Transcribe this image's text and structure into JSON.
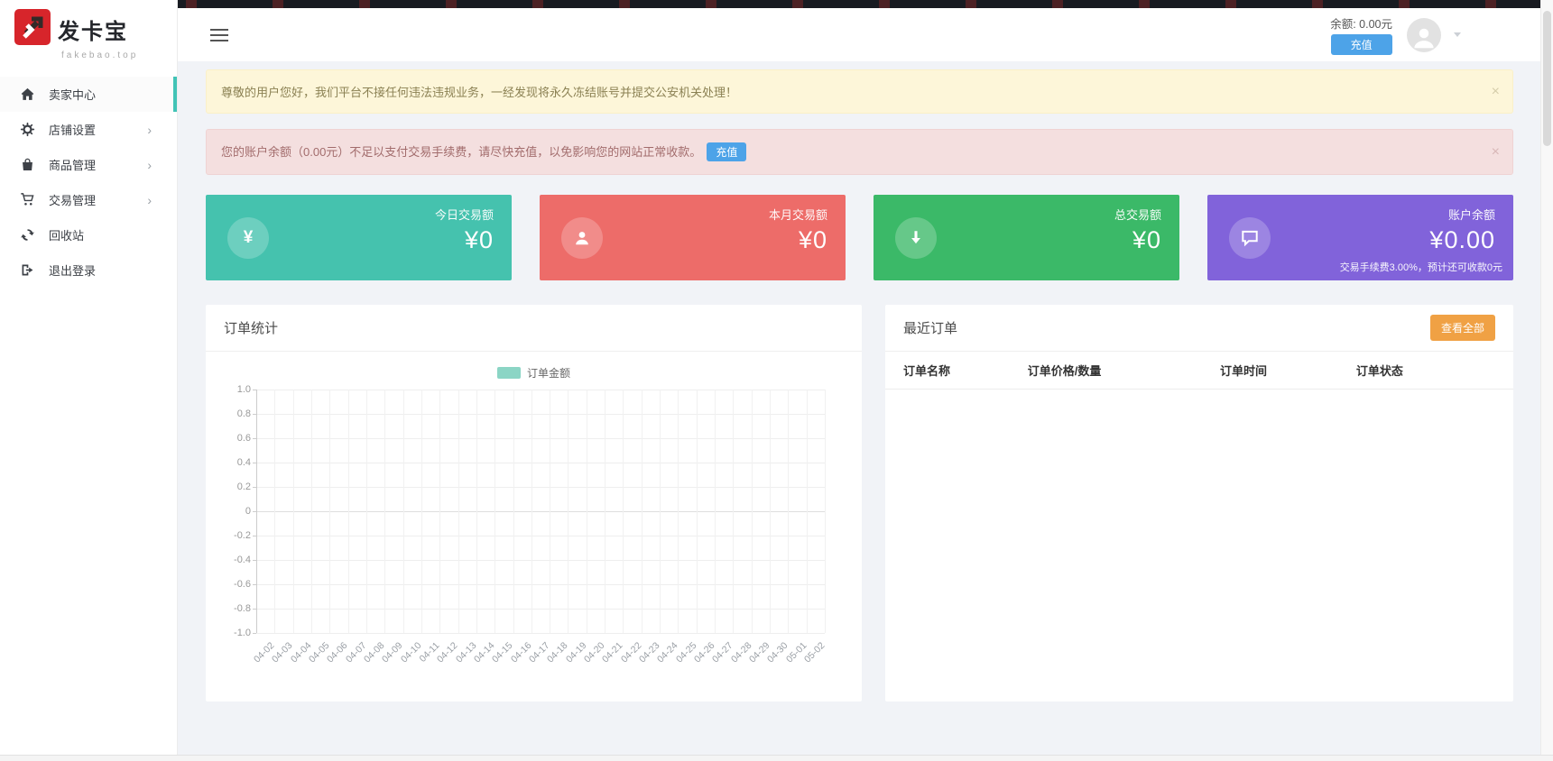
{
  "brand": {
    "name": "发卡宝",
    "domain": "fakebao.top"
  },
  "topbar": {
    "balance_label": "余额: 0.00元",
    "recharge_button": "充值"
  },
  "sidebar": {
    "items": [
      {
        "key": "seller-center",
        "label": "卖家中心",
        "icon": "home-icon",
        "active": true,
        "has_children": false
      },
      {
        "key": "shop-settings",
        "label": "店铺设置",
        "icon": "gear-icon",
        "active": false,
        "has_children": true
      },
      {
        "key": "product-management",
        "label": "商品管理",
        "icon": "bag-icon",
        "active": false,
        "has_children": true
      },
      {
        "key": "trade-management",
        "label": "交易管理",
        "icon": "cart-icon",
        "active": false,
        "has_children": true
      },
      {
        "key": "recycle-bin",
        "label": "回收站",
        "icon": "recycle-icon",
        "active": false,
        "has_children": false
      },
      {
        "key": "logout",
        "label": "退出登录",
        "icon": "logout-icon",
        "active": false,
        "has_children": false
      }
    ],
    "chevron": "›"
  },
  "alerts": [
    {
      "type": "warning",
      "text": "尊敬的用户您好，我们平台不接任何违法违规业务，一经发现将永久冻结账号并提交公安机关处理！",
      "close": "×"
    },
    {
      "type": "danger",
      "text": "您的账户余额（0.00元）不足以支付交易手续费，请尽快充值，以免影响您的网站正常收款。",
      "action": "充值",
      "close": "×"
    }
  ],
  "stat_cards": [
    {
      "key": "today-volume",
      "label": "今日交易额",
      "value": "¥0",
      "icon": "yen-icon",
      "color": "#45c2ae"
    },
    {
      "key": "month-volume",
      "label": "本月交易额",
      "value": "¥0",
      "icon": "user-icon",
      "color": "#ed6c69"
    },
    {
      "key": "total-volume",
      "label": "总交易额",
      "value": "¥0",
      "icon": "arrow-down-icon",
      "color": "#3bb968"
    },
    {
      "key": "account-balance",
      "label": "账户余额",
      "value": "¥0.00",
      "icon": "chat-bubble-icon",
      "color": "#8163da",
      "note": "交易手续费3.00%，预计还可收款0元"
    }
  ],
  "order_stats_panel": {
    "title": "订单统计"
  },
  "chart_data": {
    "type": "bar",
    "title": "订单统计",
    "legend": [
      {
        "name": "订单金额",
        "color": "#8bd5c5"
      }
    ],
    "legend_position": "top-center",
    "categories": [
      "04-02",
      "04-03",
      "04-04",
      "04-05",
      "04-06",
      "04-07",
      "04-08",
      "04-09",
      "04-10",
      "04-11",
      "04-12",
      "04-13",
      "04-14",
      "04-15",
      "04-16",
      "04-17",
      "04-18",
      "04-19",
      "04-20",
      "04-21",
      "04-22",
      "04-23",
      "04-24",
      "04-25",
      "04-26",
      "04-27",
      "04-28",
      "04-29",
      "04-30",
      "05-01",
      "05-02"
    ],
    "series": [
      {
        "name": "订单金额",
        "values": []
      }
    ],
    "ylim": [
      -1,
      1
    ],
    "yticks": [
      "1.0",
      "0.8",
      "0.6",
      "0.4",
      "0.2",
      "0",
      "-0.2",
      "-0.4",
      "-0.6",
      "-0.8",
      "-1.0"
    ],
    "grid": true
  },
  "recent_orders_panel": {
    "title": "最近订单",
    "view_all": "查看全部",
    "columns": [
      "订单名称",
      "订单价格/数量",
      "订单时间",
      "订单状态"
    ],
    "rows": []
  }
}
